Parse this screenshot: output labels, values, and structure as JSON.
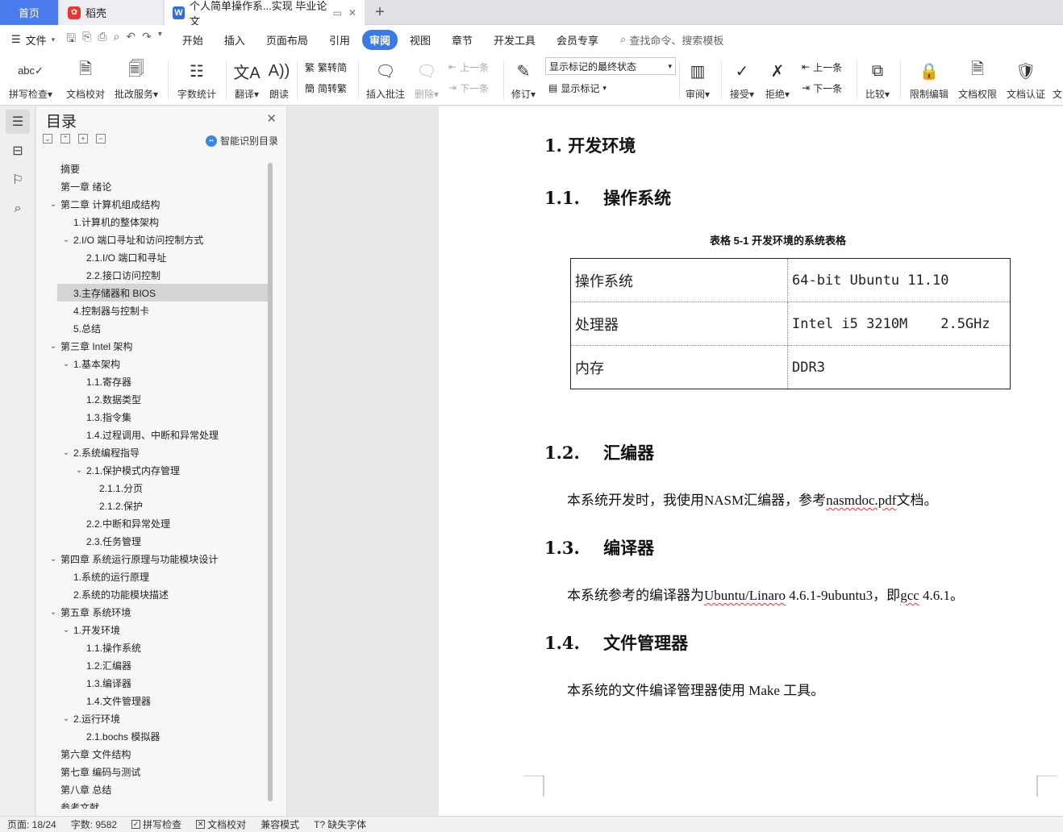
{
  "tabs": {
    "home": "首页",
    "daoke": "稻壳",
    "doc": "个人简单操作系...实现 毕业论文",
    "add": "+"
  },
  "menu": {
    "file": "文件",
    "tabs": [
      "开始",
      "插入",
      "页面布局",
      "引用",
      "审阅",
      "视图",
      "章节",
      "开发工具",
      "会员专享"
    ],
    "active": "审阅",
    "search": "查找命令、搜索模板"
  },
  "ribbon": {
    "spellcheck": "拼写检查",
    "proofread": "文档校对",
    "revise_service": "批改服务",
    "word_count": "字数统计",
    "translate": "翻译",
    "read_aloud": "朗读",
    "trad_to_simp": "繁转简",
    "simp_to_trad": "简转繁",
    "insert_comment": "插入批注",
    "delete": "删除",
    "prev_comment": "上一条",
    "next_comment": "下一条",
    "track_changes": "修订",
    "markup_state": "显示标记的最终状态",
    "show_markup": "显示标记",
    "review": "审阅",
    "accept": "接受",
    "reject": "拒绝",
    "prev_change": "上一条",
    "next_change": "下一条",
    "compare": "比较",
    "restrict_edit": "限制编辑",
    "doc_permission": "文档权限",
    "doc_cert": "文档认证",
    "more": "文"
  },
  "toc": {
    "title": "目录",
    "smart": "智能识别目录",
    "items": [
      {
        "text": "摘要",
        "level": 0,
        "chev": false
      },
      {
        "text": "第一章  绪论",
        "level": 0,
        "chev": false
      },
      {
        "text": "第二章  计算机组成结构",
        "level": 0,
        "chev": true
      },
      {
        "text": "1.计算机的整体架构",
        "level": 1,
        "chev": false
      },
      {
        "text": "2.I/O 端口寻址和访问控制方式",
        "level": 1,
        "chev": true
      },
      {
        "text": "2.1.I/O 端口和寻址",
        "level": 2,
        "chev": false
      },
      {
        "text": "2.2.接口访问控制",
        "level": 2,
        "chev": false
      },
      {
        "text": "3.主存储器和 BIOS",
        "level": 1,
        "chev": false,
        "selected": true
      },
      {
        "text": "4.控制器与控制卡",
        "level": 1,
        "chev": false
      },
      {
        "text": "5.总结",
        "level": 1,
        "chev": false
      },
      {
        "text": "第三章  Intel 架构",
        "level": 0,
        "chev": true
      },
      {
        "text": "1.基本架构",
        "level": 1,
        "chev": true
      },
      {
        "text": "1.1.寄存器",
        "level": 2,
        "chev": false
      },
      {
        "text": "1.2.数据类型",
        "level": 2,
        "chev": false
      },
      {
        "text": "1.3.指令集",
        "level": 2,
        "chev": false
      },
      {
        "text": "1.4.过程调用、中断和异常处理",
        "level": 2,
        "chev": false
      },
      {
        "text": "2.系统编程指导",
        "level": 1,
        "chev": true
      },
      {
        "text": "2.1.保护模式内存管理",
        "level": 2,
        "chev": true
      },
      {
        "text": "2.1.1.分页",
        "level": 3,
        "chev": false
      },
      {
        "text": "2.1.2.保护",
        "level": 3,
        "chev": false
      },
      {
        "text": "2.2.中断和异常处理",
        "level": 2,
        "chev": false
      },
      {
        "text": "2.3.任务管理",
        "level": 2,
        "chev": false
      },
      {
        "text": "第四章  系统运行原理与功能模块设计",
        "level": 0,
        "chev": true
      },
      {
        "text": "1.系统的运行原理",
        "level": 1,
        "chev": false
      },
      {
        "text": "2.系统的功能模块描述",
        "level": 1,
        "chev": false
      },
      {
        "text": "第五章  系统环境",
        "level": 0,
        "chev": true
      },
      {
        "text": "1.开发环境",
        "level": 1,
        "chev": true
      },
      {
        "text": "1.1.操作系统",
        "level": 2,
        "chev": false
      },
      {
        "text": "1.2.汇编器",
        "level": 2,
        "chev": false
      },
      {
        "text": "1.3.编译器",
        "level": 2,
        "chev": false
      },
      {
        "text": "1.4.文件管理器",
        "level": 2,
        "chev": false
      },
      {
        "text": "2.运行环境",
        "level": 1,
        "chev": true
      },
      {
        "text": "2.1.bochs 模拟器",
        "level": 2,
        "chev": false
      },
      {
        "text": "第六章  文件结构",
        "level": 0,
        "chev": false
      },
      {
        "text": "第七章  编码与测试",
        "level": 0,
        "chev": false
      },
      {
        "text": "第八章  总结",
        "level": 0,
        "chev": false
      },
      {
        "text": "参考文献",
        "level": 0,
        "chev": false
      }
    ]
  },
  "doc": {
    "h1": "1.  开发环境",
    "h11": "1.1.    操作系统",
    "caption": "表格  5-1  开发环境的系统表格",
    "table": [
      {
        "k": "操作系统",
        "v": "64-bit Ubuntu 11.10"
      },
      {
        "k": "处理器",
        "v": "Intel i5 3210M    2.5GHz"
      },
      {
        "k": "内存",
        "v": "DDR3"
      }
    ],
    "h12": "1.2.    汇编器",
    "p12_a": "本系统开发时，我使用NASM汇编器，参考",
    "p12_b": "nasmdoc.pdf",
    "p12_c": "文档。",
    "h13": "1.3.    编译器",
    "p13_a": "本系统参考的编译器为",
    "p13_b": "Ubuntu/Linaro",
    "p13_c": " 4.6.1-9ubuntu3，即",
    "p13_d": "gcc",
    "p13_e": " 4.6.1。",
    "h14": "1.4.    文件管理器",
    "p14": "本系统的文件编译管理器使用 Make 工具。"
  },
  "status": {
    "page": "页面: 18/24",
    "words": "字数: 9582",
    "spell": "拼写检查",
    "proof": "文档校对",
    "compat": "兼容模式",
    "missing_font": "缺失字体"
  }
}
